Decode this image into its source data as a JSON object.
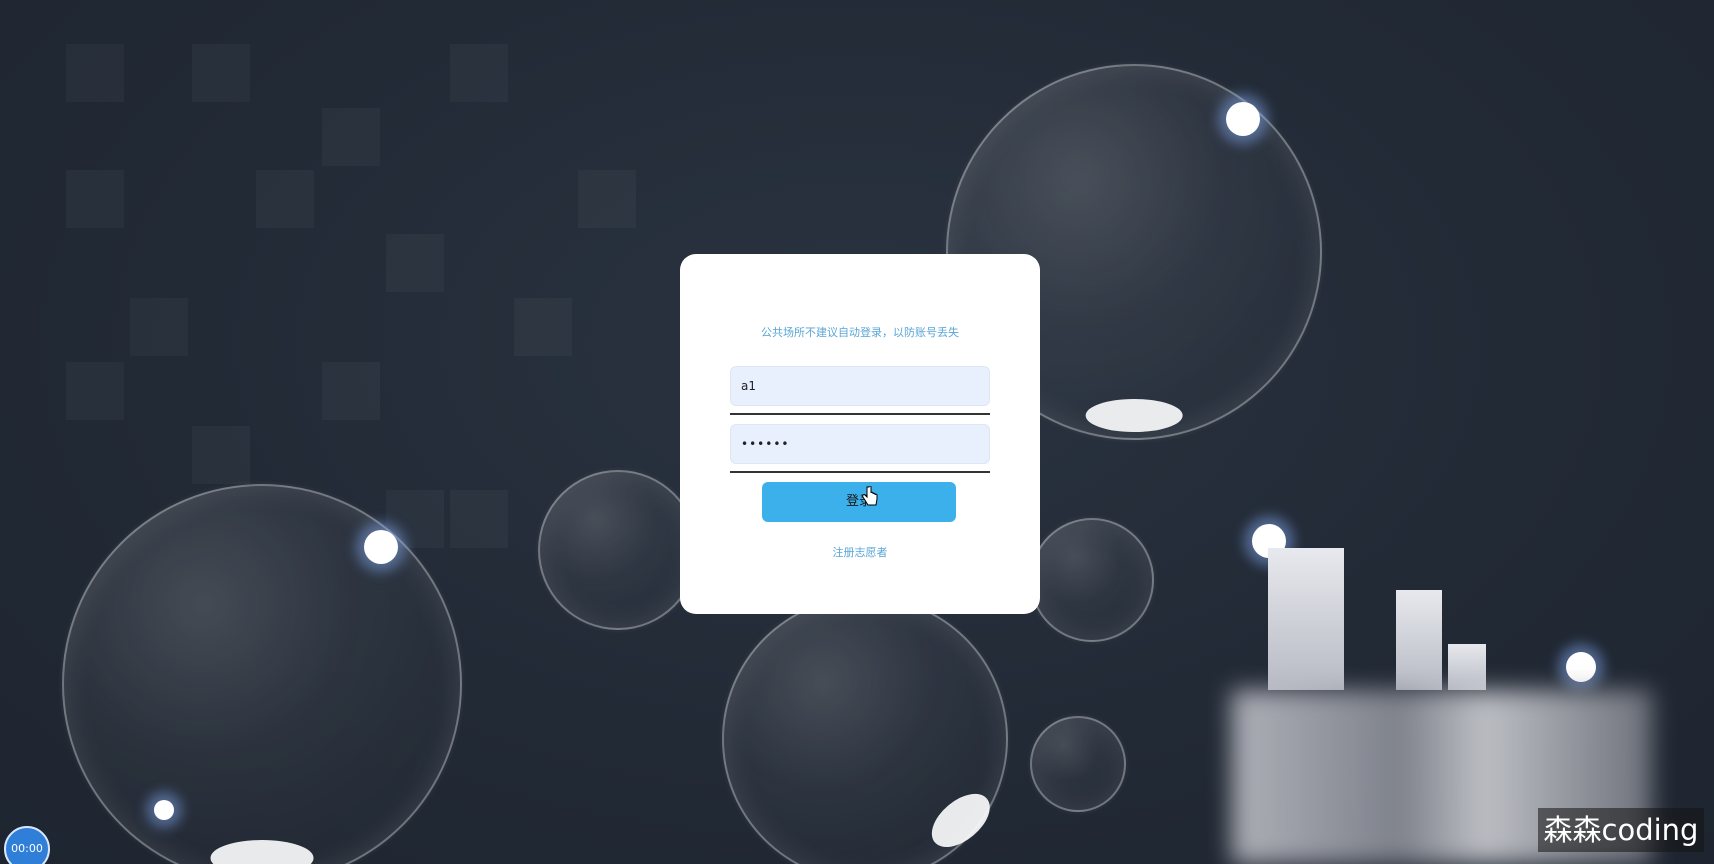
{
  "login": {
    "notice": "公共场所不建议自动登录，以防账号丢失",
    "username_value": "a1",
    "password_value": "••••••",
    "login_label": "登录",
    "register_label": "注册志愿者"
  },
  "overlay": {
    "timer": "00:00",
    "watermark": "森森coding"
  },
  "colors": {
    "background": "#222a36",
    "accent": "#3bb0ea",
    "link": "#5aa6d6",
    "input_bg": "#e8f0fe"
  }
}
